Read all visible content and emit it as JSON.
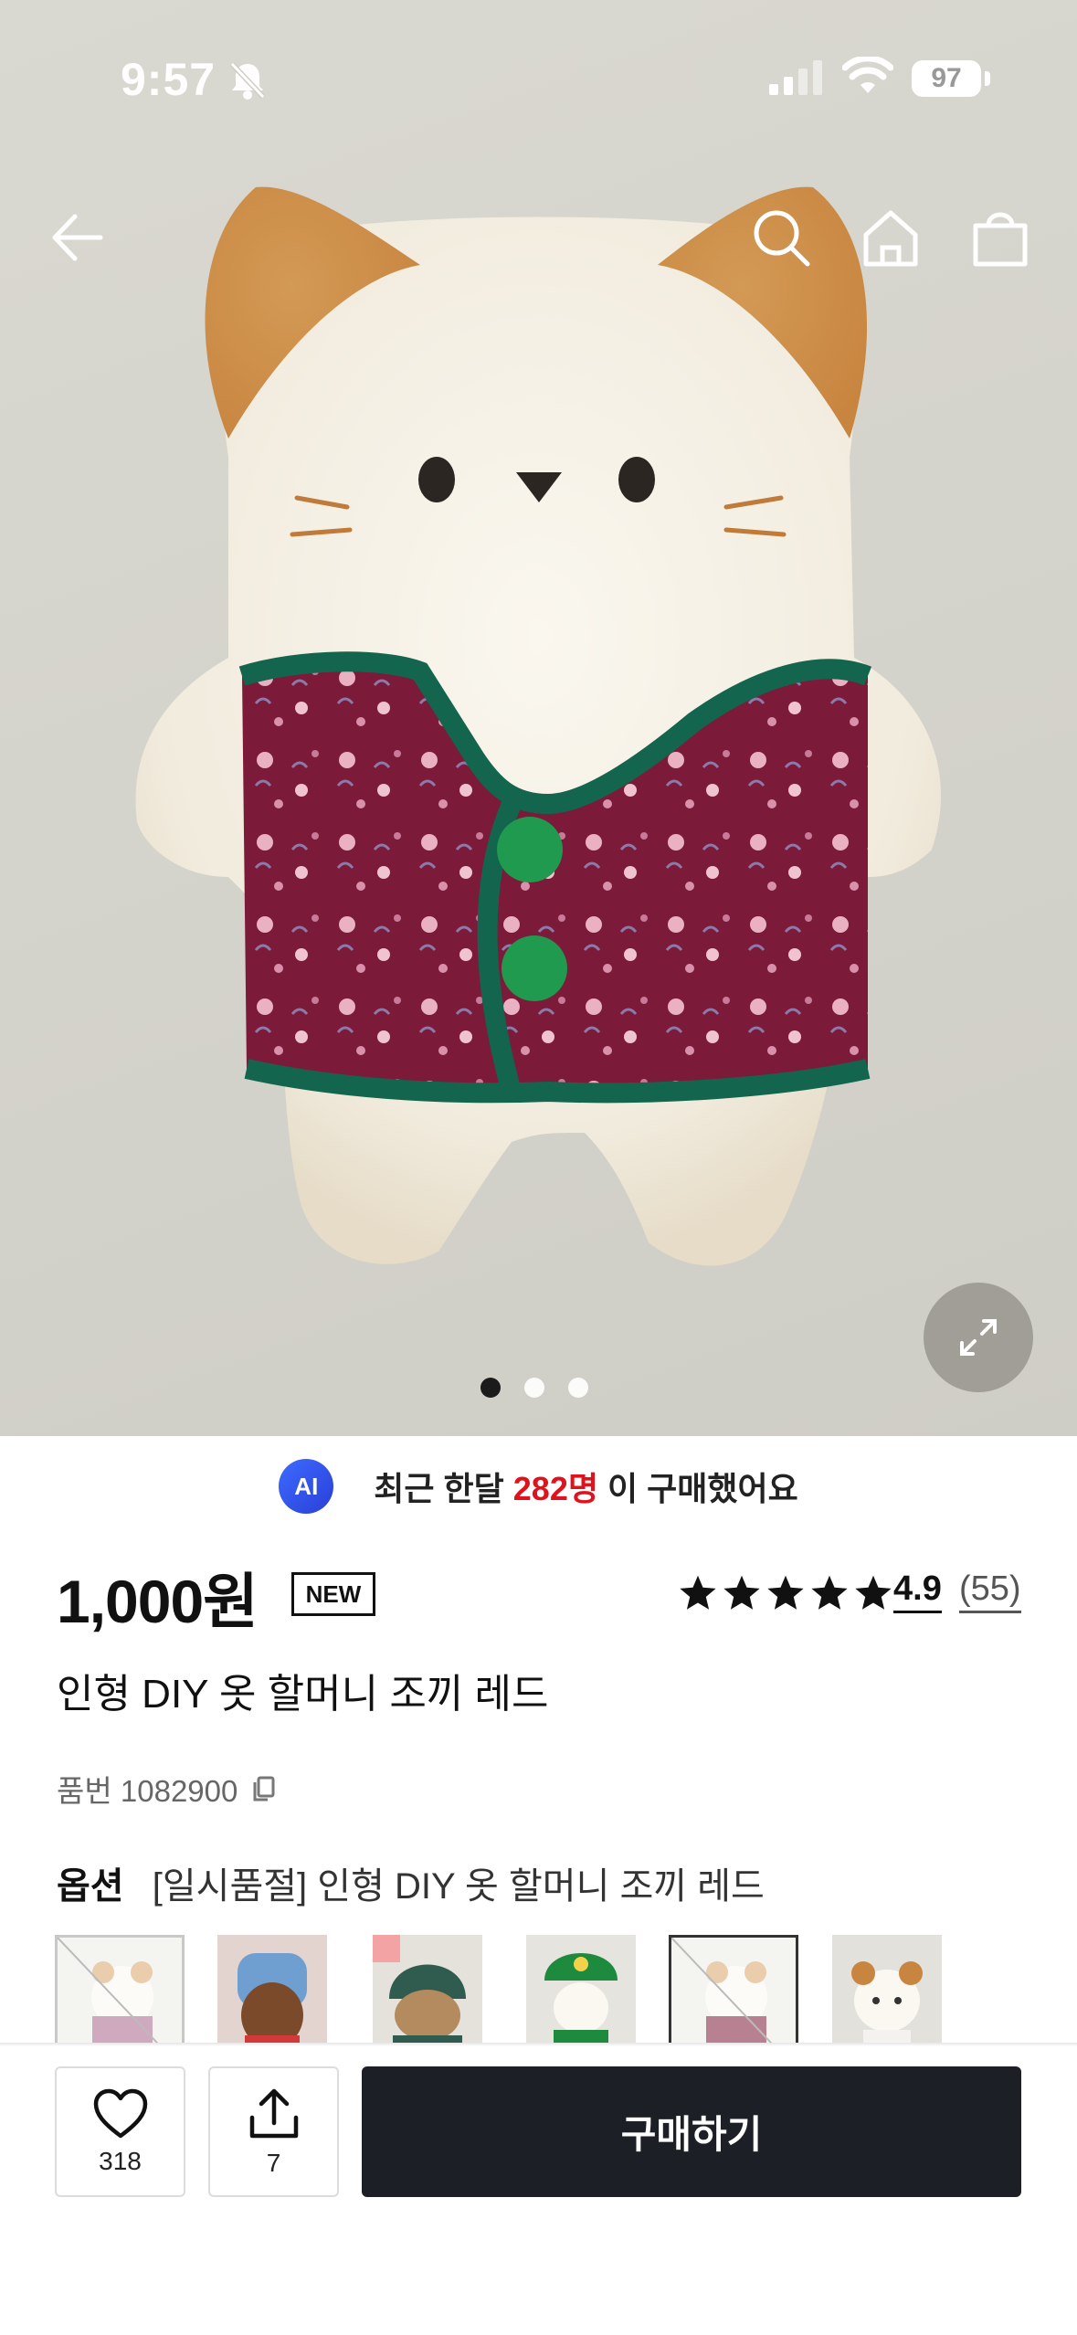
{
  "status_bar": {
    "time": "9:57",
    "battery": "97"
  },
  "nav": {
    "back_icon": "arrow-left-icon",
    "search_icon": "search-icon",
    "home_icon": "home-icon",
    "cart_icon": "shopping-bag-icon"
  },
  "gallery": {
    "image_subject": "cat-doll-wearing-quilted-vest",
    "page_count": 3,
    "current_page": 1,
    "expand_icon": "expand-icon"
  },
  "promo": {
    "ai_label": "AI",
    "prefix": "최근 한달",
    "count": "282명",
    "suffix": "이 구매했어요",
    "accent_color": "#e0121d"
  },
  "product": {
    "price": "1,000원",
    "new_badge": "NEW",
    "rating": "4.9",
    "review_count": "(55)",
    "stars": 5,
    "title": "인형 DIY 옷 할머니 조끼 레드",
    "sku_label": "품번 1082900",
    "copy_icon": "copy-icon"
  },
  "options": {
    "label": "옵션",
    "selected": "[일시품절] 인형 DIY 옷 할머니 조끼 레드",
    "thumbnails": [
      {
        "name": "thumb-option-1",
        "variant": "sold-out"
      },
      {
        "name": "thumb-option-2",
        "variant": "blue-hood"
      },
      {
        "name": "thumb-option-3",
        "variant": "green-hat"
      },
      {
        "name": "thumb-option-4",
        "variant": "green-cap"
      },
      {
        "name": "thumb-option-5",
        "variant": "sold-out-selected"
      },
      {
        "name": "thumb-option-6",
        "variant": "cat-white"
      }
    ]
  },
  "bottom_bar": {
    "like_count": "318",
    "share_count": "7",
    "buy_label": "구매하기",
    "buy_color": "#1c1f26"
  }
}
